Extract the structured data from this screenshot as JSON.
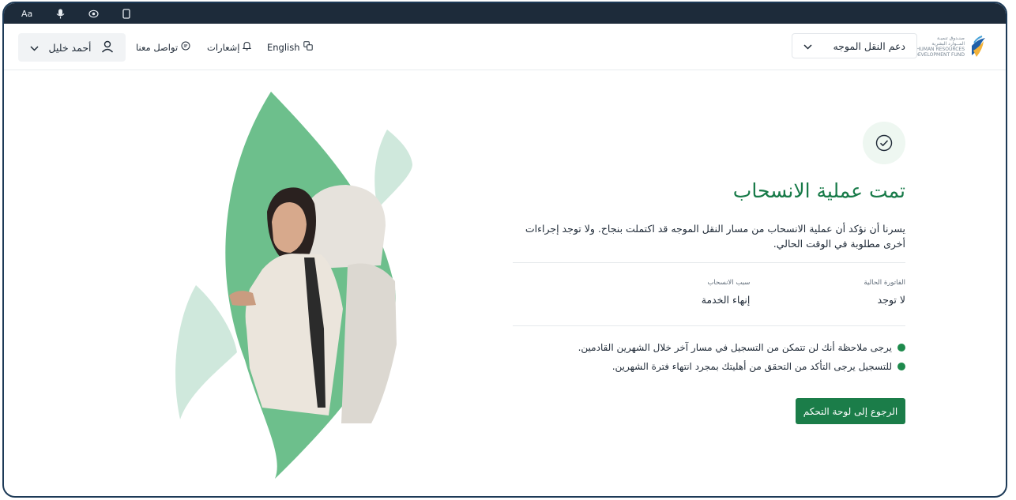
{
  "toolbar": {
    "font_label": "Aa",
    "icons": [
      "mic-icon",
      "eye-icon",
      "device-icon"
    ]
  },
  "header": {
    "logo_text": [
      "صنـدوق تنميـة",
      "المــوارد البشرية",
      "HUMAN RESOURCES",
      "DEVELOPMENT FUND"
    ],
    "support_menu_label": "دعم النقل الموجه",
    "language_label": "English",
    "notifications_label": "إشعارات",
    "contact_label": "تواصل معنا",
    "user_name": "أحمد خليل"
  },
  "main": {
    "title": "تمت عملية الانسحاب",
    "description": "يسرنا أن نؤكد أن عملية الانسحاب من مسار النقل الموجه قد اكتملت بنجاح. ولا توجد إجراءات أخرى مطلوبة في الوقت الحالي.",
    "current_invoice_label": "الفاتورة الحالية",
    "current_invoice_value": "لا توجد",
    "withdrawal_reason_label": "سبب الانسحاب",
    "withdrawal_reason_value": "إنهاء الخدمة",
    "notes": [
      "يرجى ملاحظة أنك لن تتمكن من التسجيل في مسار آخر خلال الشهرين القادمين.",
      "للتسجيل يرجى التأكد من التحقق من أهليتك بمجرد انتهاء فترة الشهرين."
    ],
    "back_button_label": "الرجوع إلى لوحة التحكم"
  },
  "colors": {
    "brand_green": "#1b7d49",
    "leaf_green": "#6dbf8c",
    "leaf_light": "#cfe8dc",
    "top_bar": "#1d2b3a"
  }
}
